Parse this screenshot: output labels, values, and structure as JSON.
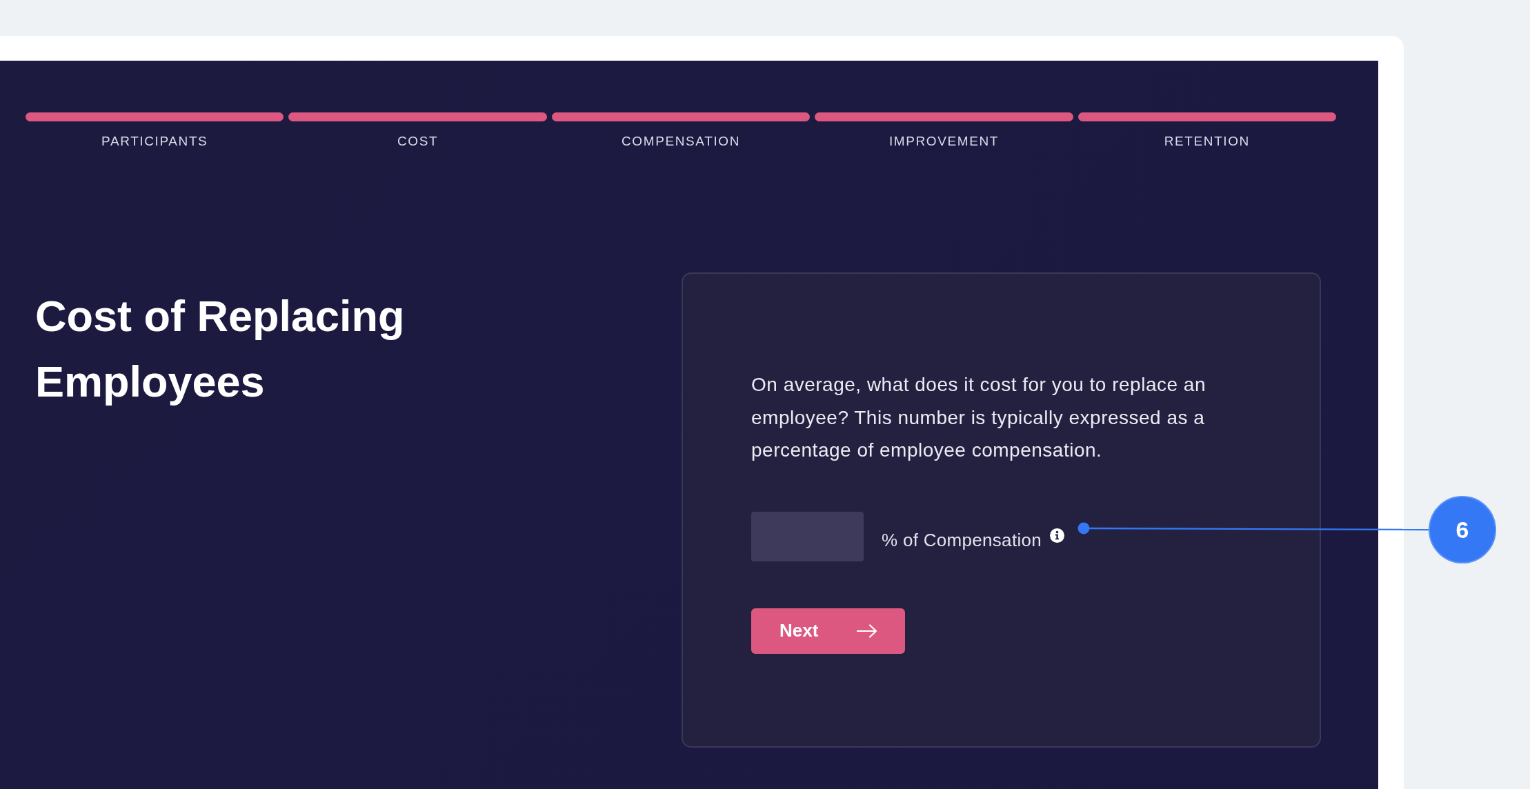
{
  "steps": [
    {
      "label": "PARTICIPANTS",
      "completed": true
    },
    {
      "label": "COST",
      "completed": true
    },
    {
      "label": "COMPENSATION",
      "completed": true
    },
    {
      "label": "IMPROVEMENT",
      "completed": true
    },
    {
      "label": "RETENTION",
      "completed": true
    }
  ],
  "heading": "Cost of Replacing Employees",
  "question_card": {
    "prompt": "On average, what does it cost for you to replace an employee? This number is typically expressed as a percentage of employee compensation.",
    "answer_field": {
      "unit_label": "% of Compensation"
    },
    "next_button": {
      "label": "Next"
    }
  },
  "callout": {
    "number": "6"
  }
}
